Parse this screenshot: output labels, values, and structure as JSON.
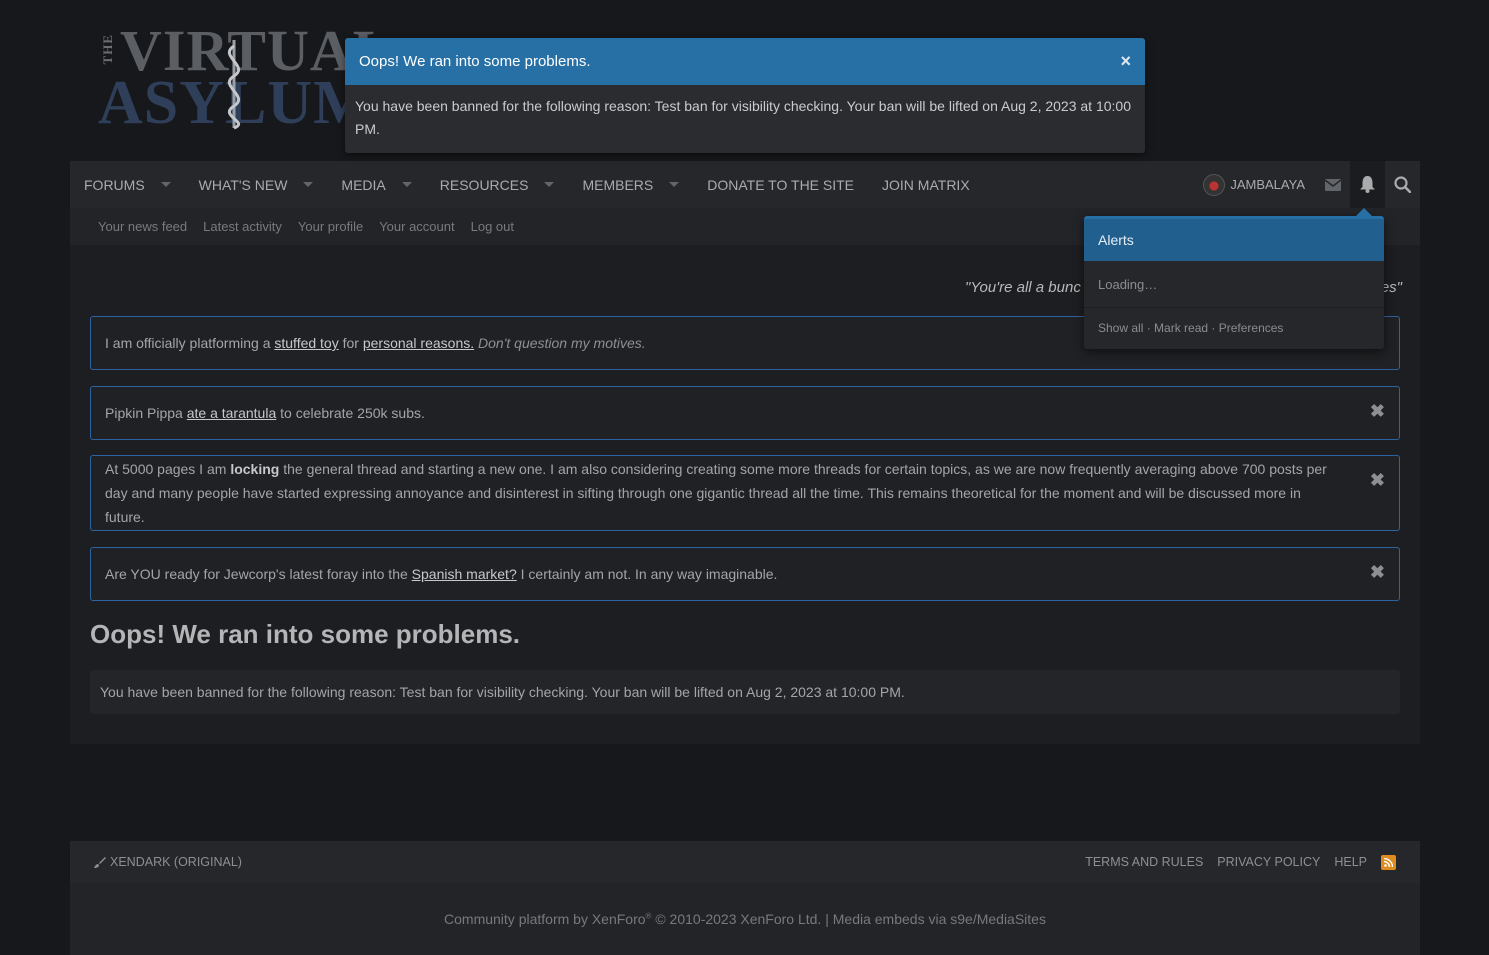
{
  "logo": {
    "the": "THE",
    "line1": "VIRTUAL",
    "line2": "ASYLUM"
  },
  "banner": {
    "title": "Oops! We ran into some problems.",
    "close": "×",
    "message": "You have been banned for the following reason: Test ban for visibility checking. Your ban will be lifted on Aug 2, 2023 at 10:00 PM."
  },
  "nav": {
    "items": [
      {
        "label": "Forums"
      },
      {
        "label": "What's new"
      },
      {
        "label": "Media"
      },
      {
        "label": "Resources"
      },
      {
        "label": "Members"
      },
      {
        "label": "Donate to the site"
      },
      {
        "label": "Join Matrix"
      }
    ],
    "user": "Jambalaya",
    "icons": [
      "envelope-icon",
      "bell-icon",
      "search-icon"
    ]
  },
  "subnav": [
    "Your news feed",
    "Latest activity",
    "Your profile",
    "Your account",
    "Log out"
  ],
  "quote": "\"You're all a bunc",
  "quote_tail": "es\"",
  "notices": [
    {
      "pre": "I am officially platforming a ",
      "link1": "stuffed toy",
      "mid": " for ",
      "link2": "personal reasons.",
      "tail": "Don't question my motives."
    },
    {
      "pre": "Pipkin Pippa ",
      "link": "ate a tarantula",
      "post": " to celebrate 250k subs."
    },
    {
      "pre": "At 5000 pages I am ",
      "bold": "locking",
      "post": " the general thread and starting a new one. I am also considering creating some more threads for certain topics, as we are now frequently averaging above 700 posts per day and many people have started expressing annoyance and disinterest in sifting through one gigantic thread all the time. This remains theoretical for the moment and will be discussed more in future."
    },
    {
      "pre": "Are YOU ready for Jewcorp's latest foray into the ",
      "link": "Spanish market?",
      "post": " I certainly am not. In any way imaginable."
    }
  ],
  "notice_close": "✖",
  "error": {
    "title": "Oops! We ran into some problems.",
    "message": "You have been banned for the following reason: Test ban for visibility checking. Your ban will be lifted on Aug 2, 2023 at 10:00 PM."
  },
  "alerts": {
    "title": "Alerts",
    "loading": "Loading…",
    "show_all": "Show all",
    "mark_read": "Mark read",
    "preferences": "Preferences",
    "separator": " · "
  },
  "footer": {
    "style": "XenDark (Original)",
    "links": [
      "Terms and rules",
      "Privacy policy",
      "Help"
    ],
    "copy_pre": "Community platform by XenForo",
    "copy_sup": "®",
    "copy_post": " © 2010-2023 XenForo Ltd. | Media embeds via s9e/MediaSites"
  },
  "colors": {
    "accent": "#2670a6",
    "notice_border": "#2f62a0",
    "rss": "#e08b1d"
  }
}
